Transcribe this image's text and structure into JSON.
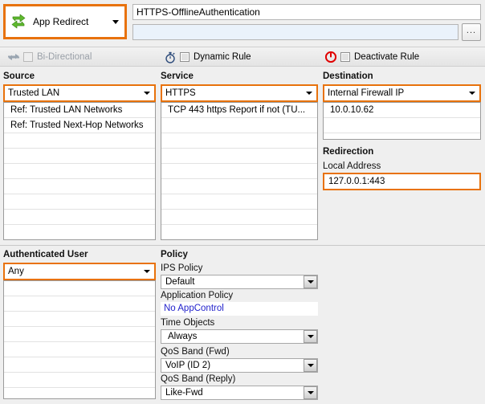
{
  "action": {
    "icon": "redirect-arrows-icon",
    "label": "App Redirect",
    "accent_color": "#e8720c"
  },
  "rule_name": {
    "value": "HTTPS-OfflineAuthentication",
    "placeholder": ""
  },
  "comment": {
    "value": "",
    "placeholder": ""
  },
  "browse_button": {
    "label": "...",
    "icon": "ellipsis-icon"
  },
  "toolbar": {
    "bi_directional": {
      "label": "Bi-Directional",
      "icon": "bi-directional-arrows-icon",
      "checked": false,
      "disabled": true
    },
    "dynamic_rule": {
      "label": "Dynamic Rule",
      "icon": "stopwatch-icon",
      "checked": false,
      "disabled": false
    },
    "deactivate_rule": {
      "label": "Deactivate Rule",
      "icon": "power-icon",
      "checked": false,
      "disabled": false
    }
  },
  "source": {
    "heading": "Source",
    "selected": "Trusted  LAN",
    "items": [
      "Ref: Trusted LAN Networks",
      "Ref: Trusted Next-Hop Networks"
    ]
  },
  "service": {
    "heading": "Service",
    "selected": "HTTPS",
    "items": [
      "TCP  443 https  Report if not (TU..."
    ]
  },
  "destination": {
    "heading": "Destination",
    "selected": "Internal Firewall IP",
    "items": [
      "10.0.10.62"
    ]
  },
  "redirection": {
    "heading": "Redirection",
    "local_address_label": "Local Address",
    "local_address_value": "127.0.0.1:443"
  },
  "authenticated_user": {
    "heading": "Authenticated User",
    "selected": "Any",
    "items": []
  },
  "policy": {
    "heading": "Policy",
    "fields": [
      {
        "label": "IPS Policy",
        "value": "Default",
        "kind": "combo"
      },
      {
        "label": "Application Policy",
        "value": "No AppControl",
        "kind": "link"
      },
      {
        "label": "Time Objects",
        "value": "Always",
        "kind": "combo"
      },
      {
        "label": "QoS Band (Fwd)",
        "value": "VoIP (ID 2)",
        "kind": "combo"
      },
      {
        "label": "QoS Band (Reply)",
        "value": "Like-Fwd",
        "kind": "combo"
      }
    ]
  }
}
